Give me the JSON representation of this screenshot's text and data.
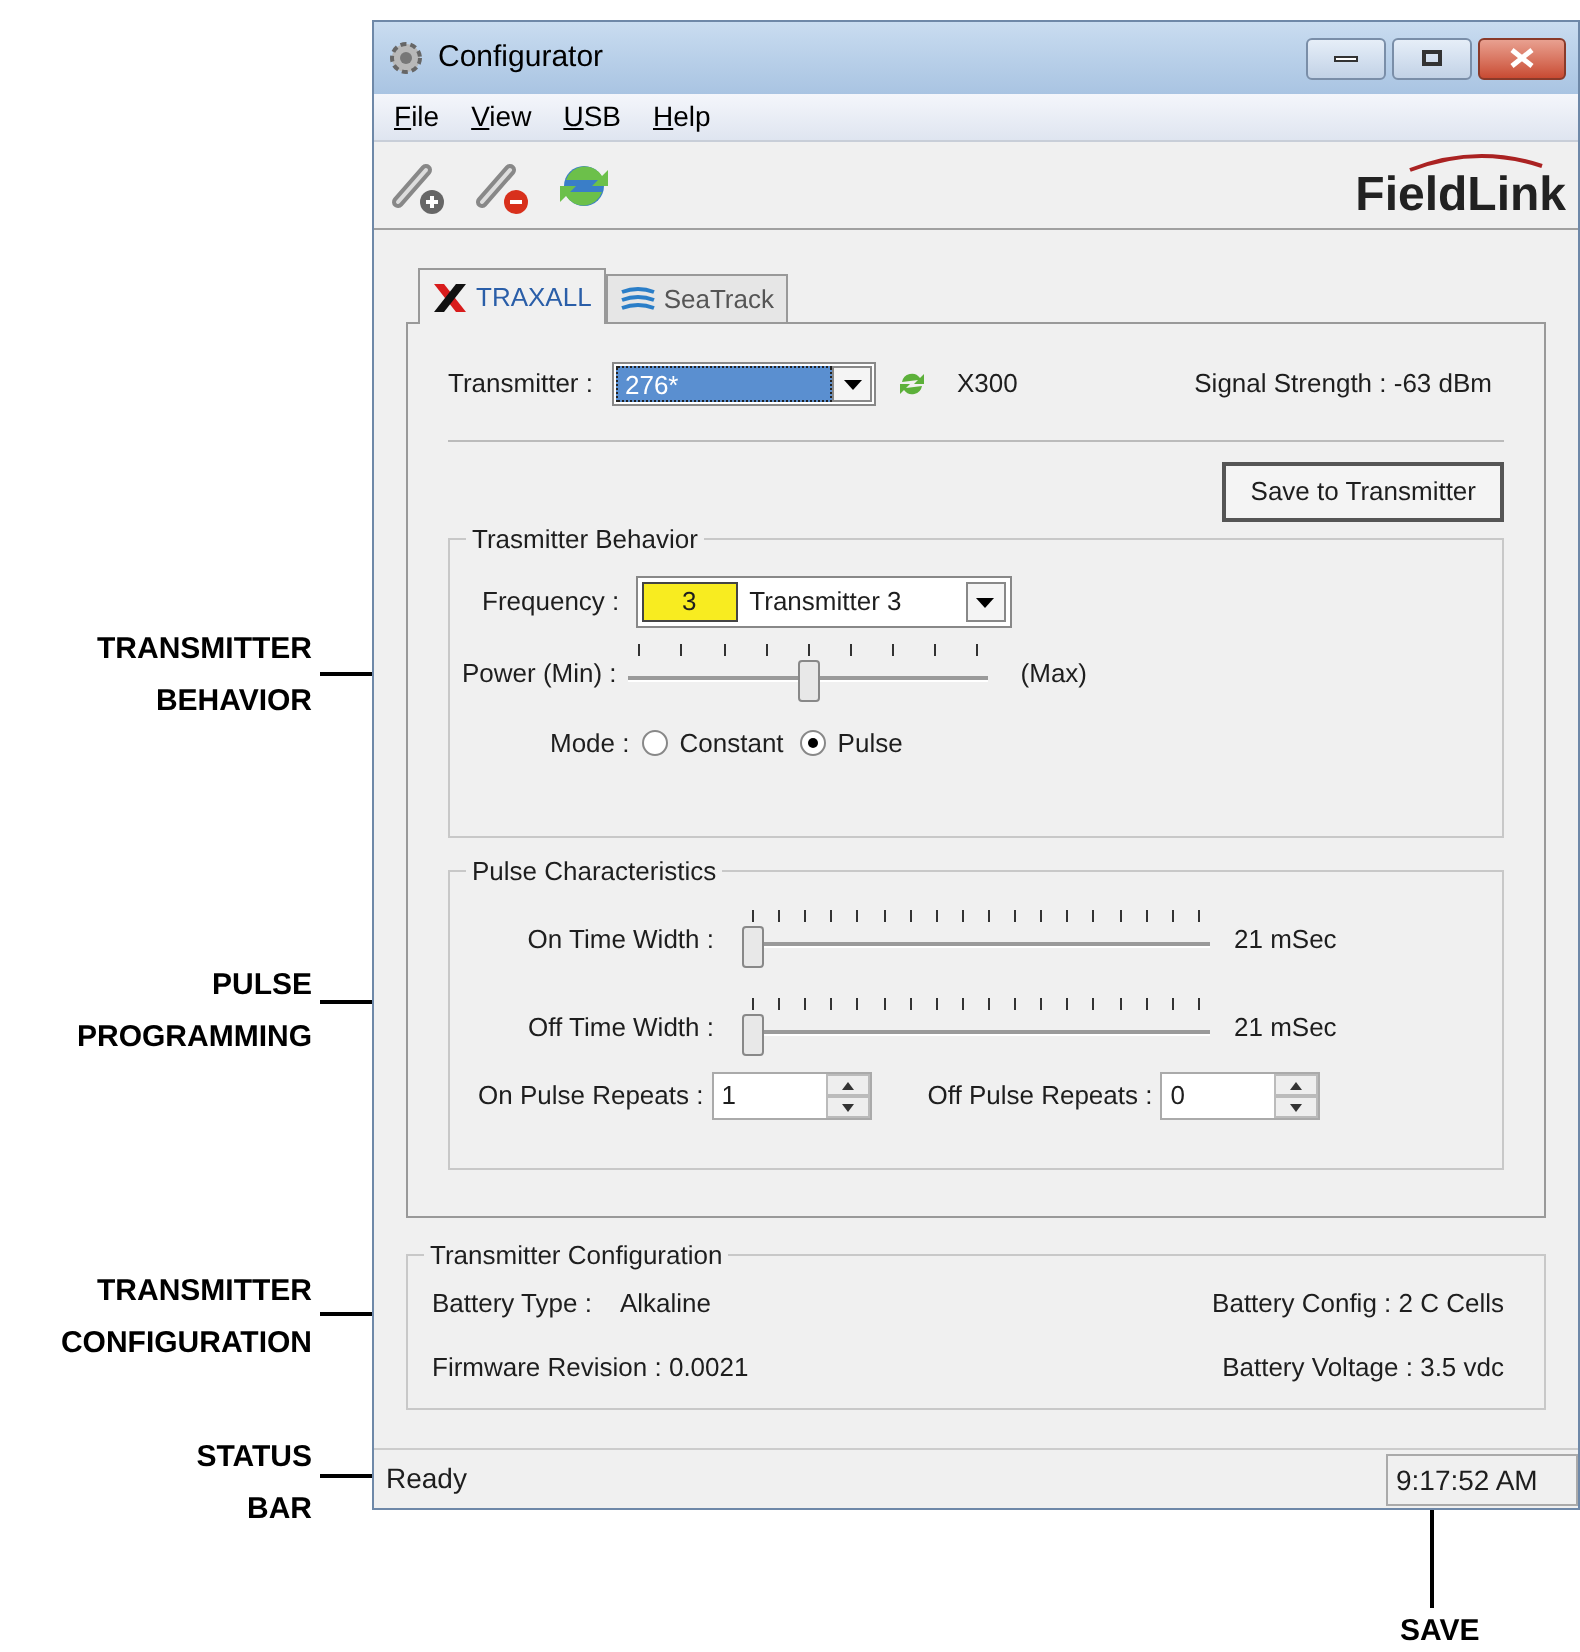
{
  "callouts": [
    {
      "lines": [
        "TRANSMITTER",
        "BEHAVIOR"
      ]
    },
    {
      "lines": [
        "PULSE",
        "PROGRAMMING"
      ]
    },
    {
      "lines": [
        "TRANSMITTER",
        "CONFIGURATION"
      ]
    },
    {
      "lines": [
        "STATUS",
        "BAR"
      ]
    },
    {
      "lines": [
        "SAVE"
      ]
    }
  ],
  "window": {
    "title": "Configurator"
  },
  "menu": [
    "File",
    "View",
    "USB",
    "Help"
  ],
  "logo": "FieldLink",
  "tabs": [
    {
      "label": "TRAXALL",
      "selected": true
    },
    {
      "label": "SeaTrack",
      "selected": false
    }
  ],
  "transmitter": {
    "label": "Transmitter :",
    "value": "276*",
    "model": "X300",
    "signal": "Signal Strength : -63 dBm"
  },
  "save_button": "Save to Transmitter",
  "behavior": {
    "title": "Trasmitter Behavior",
    "frequency_label": "Frequency :",
    "frequency_code": "3",
    "frequency_name": "Transmitter 3",
    "power_label": "Power (Min) :",
    "power_max": "(Max)",
    "power": {
      "level": 0.5
    },
    "mode_label": "Mode :",
    "modes": [
      {
        "label": "Constant",
        "selected": false
      },
      {
        "label": "Pulse",
        "selected": true
      }
    ]
  },
  "pulse": {
    "title": "Pulse Characteristics",
    "sliders": [
      {
        "label": "On Time Width :",
        "level": 0,
        "reading": "21 mSec"
      },
      {
        "label": "Off Time Width :",
        "level": 0,
        "reading": "21 mSec"
      }
    ],
    "repeats": [
      {
        "label": "On Pulse Repeats :",
        "value": "1"
      },
      {
        "label": "Off Pulse Repeats :",
        "value": "0"
      }
    ]
  },
  "config": {
    "title": "Transmitter Configuration",
    "battery_type_label": "Battery Type :",
    "battery_type": "Alkaline",
    "battery_config": "Battery Config : 2 C Cells",
    "firmware": "Firmware Revision : 0.0021",
    "voltage": "Battery Voltage : 3.5 vdc"
  },
  "status_bar": {
    "text": "Ready",
    "time": "9:17:52 AM"
  }
}
